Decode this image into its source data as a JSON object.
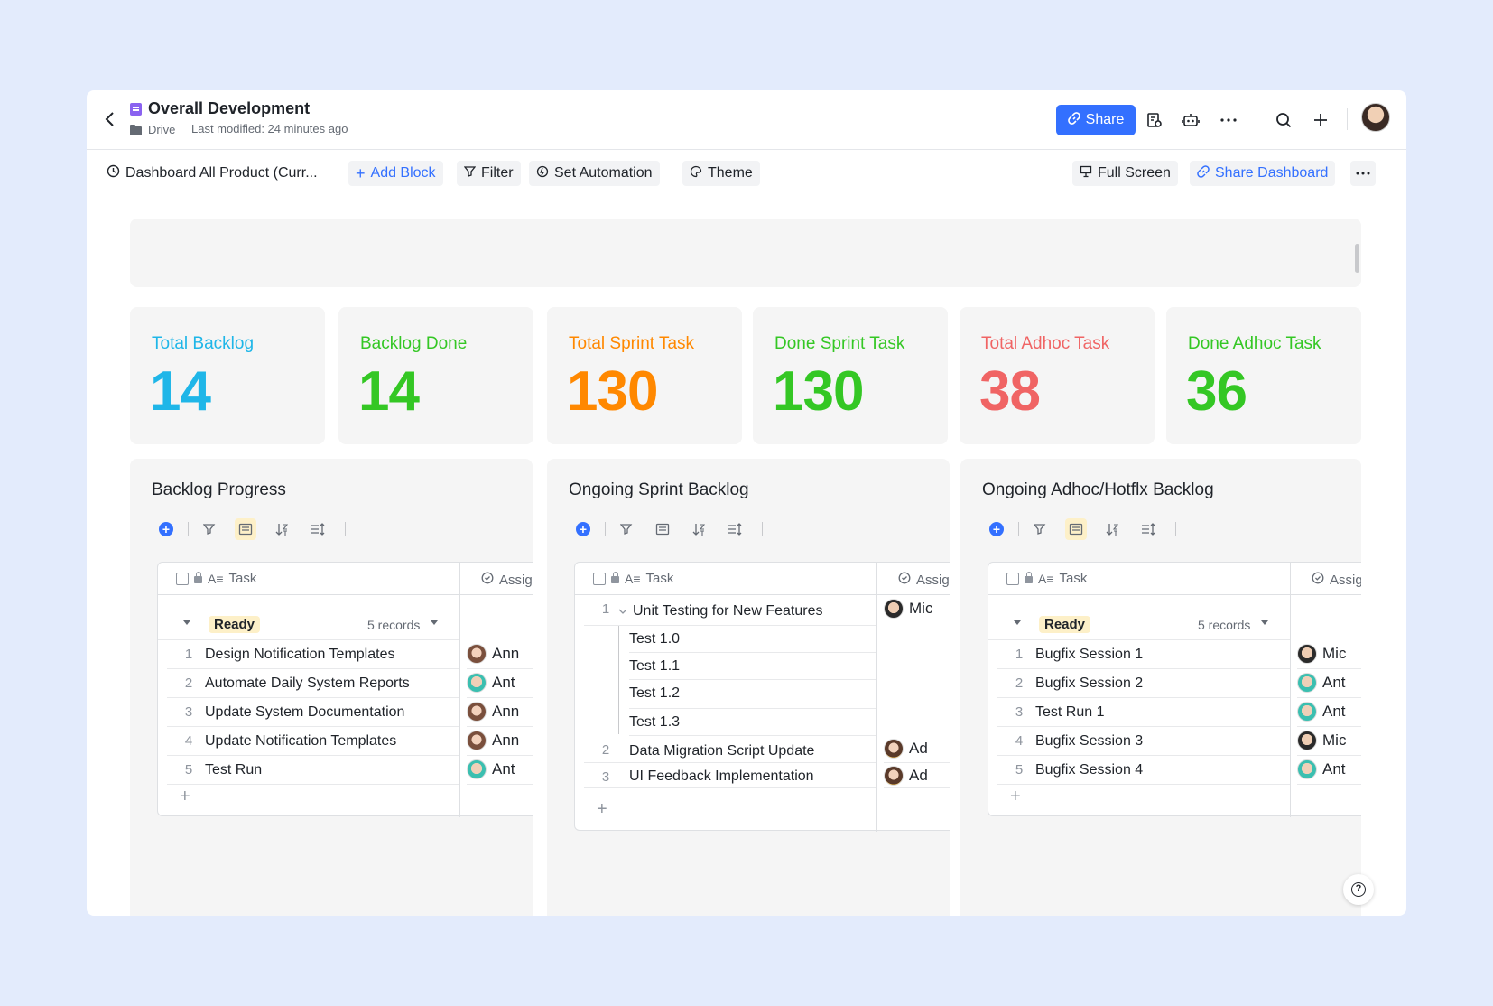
{
  "header": {
    "title": "Overall Development",
    "location": "Drive",
    "modified": "Last modified: 24 minutes ago",
    "share_label": "Share"
  },
  "toolbar": {
    "dashboard_name": "Dashboard All Product (Curr...",
    "add_block": "Add Block",
    "filter": "Filter",
    "set_automation": "Set Automation",
    "theme": "Theme",
    "full_screen": "Full Screen",
    "share_dashboard": "Share Dashboard"
  },
  "stats": [
    {
      "label": "Total Backlog",
      "value": "14",
      "color": "#1fb6e8"
    },
    {
      "label": "Backlog Done",
      "value": "14",
      "color": "#34c724"
    },
    {
      "label": "Total Sprint Task",
      "value": "130",
      "color": "#ff8800"
    },
    {
      "label": "Done Sprint Task",
      "value": "130",
      "color": "#34c724"
    },
    {
      "label": "Total Adhoc Task",
      "value": "38",
      "color": "#f06464"
    },
    {
      "label": "Done Adhoc Task",
      "value": "36",
      "color": "#34c724"
    }
  ],
  "columns": {
    "task": "Task",
    "assignee": "Assig"
  },
  "panels": {
    "backlog": {
      "title": "Backlog Progress",
      "group": "Ready",
      "records": "5 records",
      "rows": [
        {
          "num": "1",
          "task": "Design Notification Templates",
          "assignee": "Ann"
        },
        {
          "num": "2",
          "task": "Automate Daily System Reports",
          "assignee": "Ant"
        },
        {
          "num": "3",
          "task": "Update System Documentation",
          "assignee": "Ann"
        },
        {
          "num": "4",
          "task": "Update Notification Templates",
          "assignee": "Ann"
        },
        {
          "num": "5",
          "task": "Test Run",
          "assignee": "Ant"
        }
      ]
    },
    "sprint": {
      "title": "Ongoing Sprint Backlog",
      "rows": [
        {
          "num": "1",
          "task": "Unit Testing for New Features",
          "assignee": "Mic"
        },
        {
          "num": "",
          "task": "Test 1.0",
          "assignee": ""
        },
        {
          "num": "",
          "task": "Test 1.1",
          "assignee": ""
        },
        {
          "num": "",
          "task": "Test 1.2",
          "assignee": ""
        },
        {
          "num": "",
          "task": "Test 1.3",
          "assignee": ""
        },
        {
          "num": "2",
          "task": "Data Migration Script Update",
          "assignee": "Ad"
        },
        {
          "num": "3",
          "task": "UI Feedback Implementation",
          "assignee": "Ad"
        }
      ]
    },
    "adhoc": {
      "title": "Ongoing Adhoc/Hotflx Backlog",
      "group": "Ready",
      "records": "5 records",
      "rows": [
        {
          "num": "1",
          "task": "Bugfix Session 1",
          "assignee": "Mic"
        },
        {
          "num": "2",
          "task": "Bugfix Session 2",
          "assignee": "Ant"
        },
        {
          "num": "3",
          "task": "Test Run 1",
          "assignee": "Ant"
        },
        {
          "num": "4",
          "task": "Bugfix Session 3",
          "assignee": "Mic"
        },
        {
          "num": "5",
          "task": "Bugfix Session 4",
          "assignee": "Ant"
        }
      ]
    }
  }
}
